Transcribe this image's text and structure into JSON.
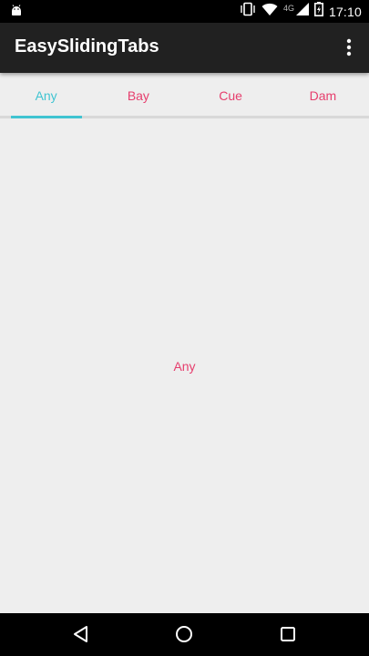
{
  "status_bar": {
    "network_type": "4G",
    "time": "17:10",
    "icons": [
      "android-debug-icon",
      "vibrate-icon",
      "wifi-icon",
      "cell-signal-icon",
      "battery-charging-icon"
    ]
  },
  "app_bar": {
    "title": "EasySlidingTabs",
    "overflow_icon": "more-vert-icon"
  },
  "tabs": [
    {
      "label": "Any",
      "active": true
    },
    {
      "label": "Bay",
      "active": false
    },
    {
      "label": "Cue",
      "active": false
    },
    {
      "label": "Dam",
      "active": false
    }
  ],
  "content": {
    "page_label": "Any"
  },
  "nav_bar": {
    "icons": [
      "back-icon",
      "home-icon",
      "recents-icon"
    ]
  },
  "colors": {
    "active_tab": "#40c4d1",
    "inactive_tab": "#e63e6d",
    "app_bar": "#212121",
    "background": "#eeeeee"
  }
}
